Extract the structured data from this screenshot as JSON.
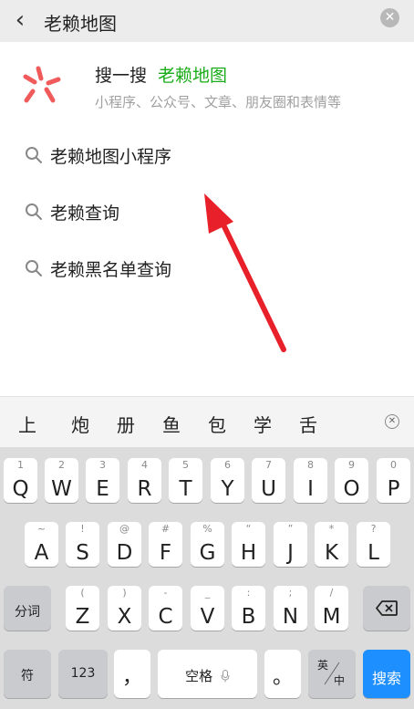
{
  "search": {
    "back_glyph": "‹",
    "query": "老赖地图",
    "clear_glyph": "✕"
  },
  "souyisou": {
    "title": "搜一搜",
    "query": "老赖地图",
    "subtitle": "小程序、公众号、文章、朋友圈和表情等",
    "accent_color": "#1aad19",
    "logo_color": "#f05a5a"
  },
  "suggestions": [
    "老赖地图小程序",
    "老赖查询",
    "老赖黑名单查询"
  ],
  "candidates": {
    "items": [
      "上",
      "炮",
      "册",
      "鱼",
      "包",
      "学",
      "舌"
    ],
    "close_glyph": "✕"
  },
  "annotation": {
    "arrow_color": "#e8202a"
  },
  "keyboard": {
    "row1": [
      {
        "key": "Q",
        "hint": "1"
      },
      {
        "key": "W",
        "hint": "2"
      },
      {
        "key": "E",
        "hint": "3"
      },
      {
        "key": "R",
        "hint": "4"
      },
      {
        "key": "T",
        "hint": "5"
      },
      {
        "key": "Y",
        "hint": "6"
      },
      {
        "key": "U",
        "hint": "7"
      },
      {
        "key": "I",
        "hint": "8"
      },
      {
        "key": "O",
        "hint": "9"
      },
      {
        "key": "P",
        "hint": "0"
      }
    ],
    "row2": [
      {
        "key": "A",
        "hint": "~"
      },
      {
        "key": "S",
        "hint": "!"
      },
      {
        "key": "D",
        "hint": "@"
      },
      {
        "key": "F",
        "hint": "#"
      },
      {
        "key": "G",
        "hint": "%"
      },
      {
        "key": "H",
        "hint": "“"
      },
      {
        "key": "J",
        "hint": "”"
      },
      {
        "key": "K",
        "hint": "*"
      },
      {
        "key": "L",
        "hint": "?"
      }
    ],
    "row3_left": "分词",
    "row3": [
      {
        "key": "Z",
        "hint": "("
      },
      {
        "key": "X",
        "hint": ")"
      },
      {
        "key": "C",
        "hint": "-"
      },
      {
        "key": "V",
        "hint": "_"
      },
      {
        "key": "B",
        "hint": ":"
      },
      {
        "key": "N",
        "hint": ";"
      },
      {
        "key": "M",
        "hint": "/"
      }
    ],
    "row4": {
      "symbol": "符",
      "num": "123",
      "comma": "，",
      "space": "空格",
      "period": "。",
      "lang_top": "英",
      "lang_bottom": "中",
      "search": "搜索"
    },
    "search_color": "#1e8fff"
  }
}
